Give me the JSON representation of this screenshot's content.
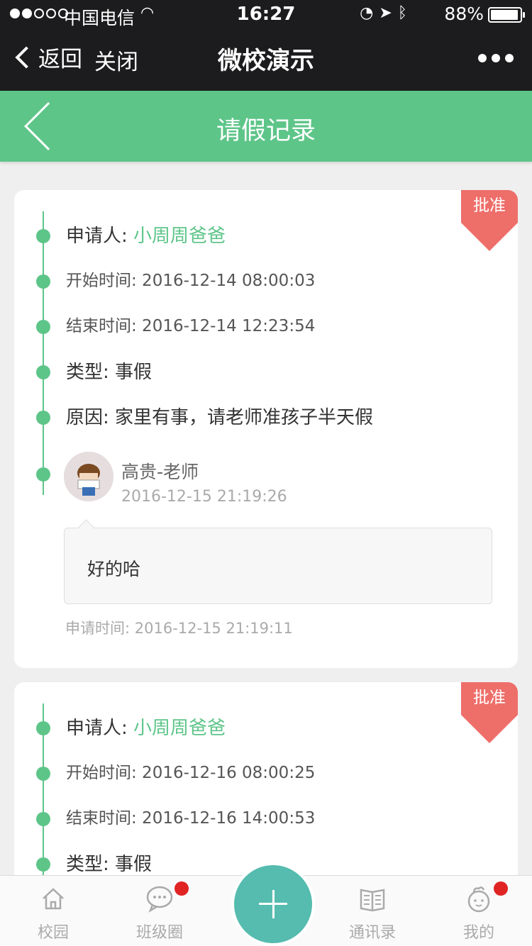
{
  "status": {
    "carrier": "中国电信",
    "time": "16:27",
    "battery": "88%"
  },
  "wechat_nav": {
    "back_label": "返回",
    "close_label": "关闭",
    "title": "微校演示"
  },
  "header": {
    "title": "请假记录"
  },
  "records": [
    {
      "status": "批准",
      "applicant_label": "申请人:",
      "applicant": "小周周爸爸",
      "start": "开始时间: 2016-12-14 08:00:03",
      "end": "结束时间: 2016-12-14 12:23:54",
      "type": "类型: 事假",
      "reason": "原因: 家里有事，请老师准孩子半天假",
      "teacher_name": "高贵-老师",
      "teacher_time": "2016-12-15 21:19:26",
      "reply": "好的哈",
      "apply_time": "申请时间: 2016-12-15 21:19:11"
    },
    {
      "status": "批准",
      "applicant_label": "申请人:",
      "applicant": "小周周爸爸",
      "start": "开始时间: 2016-12-16 08:00:25",
      "end": "结束时间: 2016-12-16 14:00:53",
      "type": "类型: 事假"
    }
  ],
  "tabs": [
    {
      "label": "校园",
      "icon": "home-icon"
    },
    {
      "label": "班级圈",
      "icon": "chat-bubble-icon"
    },
    {
      "label": "",
      "icon": "plus-icon"
    },
    {
      "label": "通讯录",
      "icon": "book-icon"
    },
    {
      "label": "我的",
      "icon": "profile-icon"
    }
  ],
  "colors": {
    "accent": "#5ec589",
    "badge": "#ee6e6a",
    "fab": "#55bcaf",
    "notification": "#e02424"
  }
}
